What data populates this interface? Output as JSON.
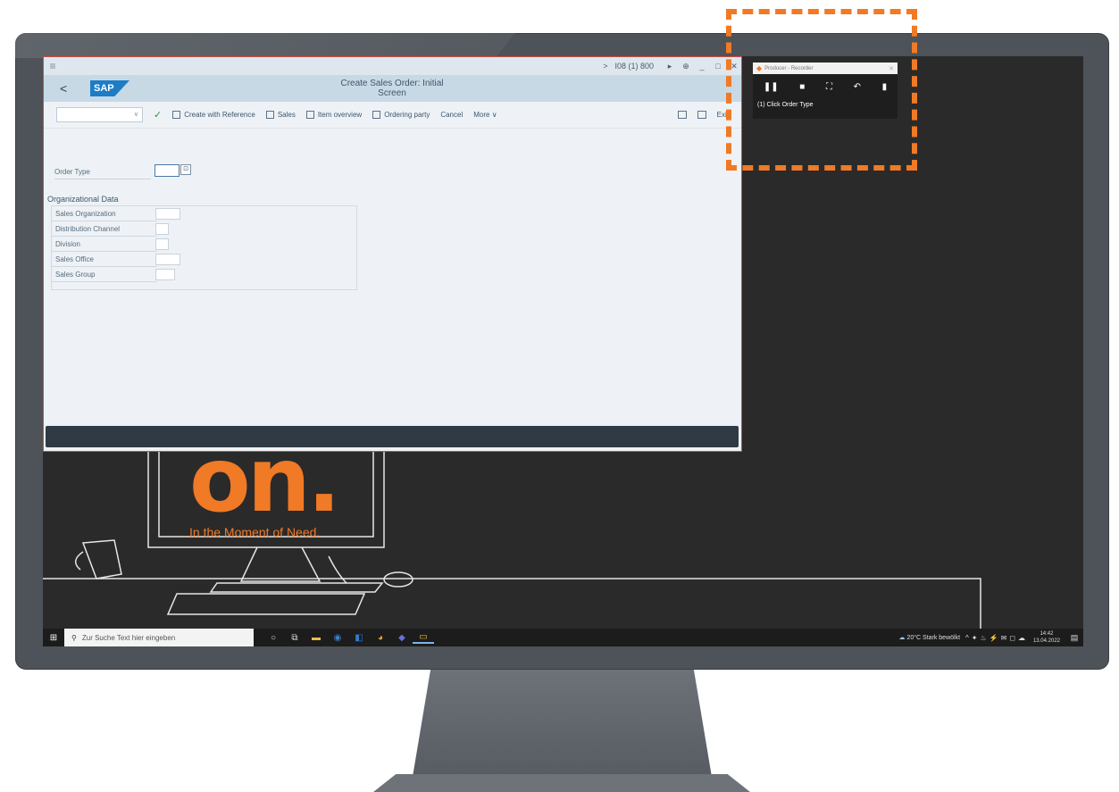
{
  "sap": {
    "title_bar": {
      "menu_glyph": "≡",
      "chevron": ">",
      "system_info": "I08 (1) 800",
      "minimize": "_",
      "maximize": "□",
      "close": "✕"
    },
    "header": {
      "back": "<",
      "logo": "SAP",
      "title": "Create Sales Order: Initial Screen"
    },
    "toolbar": {
      "create_with_reference": "Create with Reference",
      "sales": "Sales",
      "item_overview": "Item overview",
      "ordering_party": "Ordering party",
      "cancel": "Cancel",
      "more": "More",
      "exit": "Exit"
    },
    "form": {
      "order_type_label": "Order Type",
      "org_title": "Organizational Data",
      "org_fields": {
        "sales_org": "Sales Organization",
        "distribution_channel": "Distribution Channel",
        "division": "Division",
        "sales_office": "Sales Office",
        "sales_group": "Sales Group"
      }
    }
  },
  "recorder": {
    "title": "Producer - Recorder",
    "step": "(1) Click Order Type"
  },
  "wallpaper": {
    "big_text": "on.",
    "tagline": "In the Moment of Need."
  },
  "taskbar": {
    "search_placeholder": "Zur Suche Text hier eingeben",
    "weather": "20°C  Stark bewölkt",
    "time": "14:42",
    "date": "13.04.2022"
  },
  "colors": {
    "accent_orange": "#f07a25",
    "sap_blue": "#1d7cc6",
    "sap_header": "#c8d9e6"
  }
}
